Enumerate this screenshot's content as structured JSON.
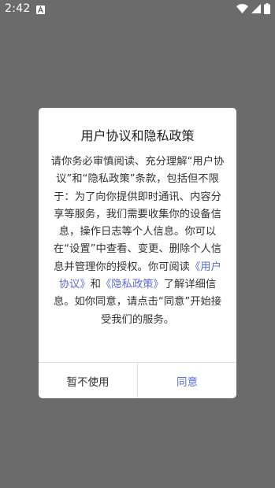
{
  "status_bar": {
    "time": "2:42"
  },
  "dialog": {
    "title": "用户协议和隐私政策",
    "body_part1": "请你务必审慎阅读、充分理解“用户协议”和“隐私政策”条款，包括但不限于：为了向你提供即时通讯、内容分享等服务，我们需要收集你的设备信息，操作日志等个人信息。你可以在“设置”中查看、变更、删除个人信息并管理你的授权。你可阅读",
    "link_user_agreement": "《用户协议》",
    "body_and": "和",
    "link_privacy_policy": "《隐私政策》",
    "body_part2": "了解详细信息。如你同意，请点击“同意”开始接受我们的服务。",
    "decline_label": "暂不使用",
    "agree_label": "同意"
  },
  "colors": {
    "overlay": "#6b6b6b",
    "link": "#5b6cd6"
  }
}
